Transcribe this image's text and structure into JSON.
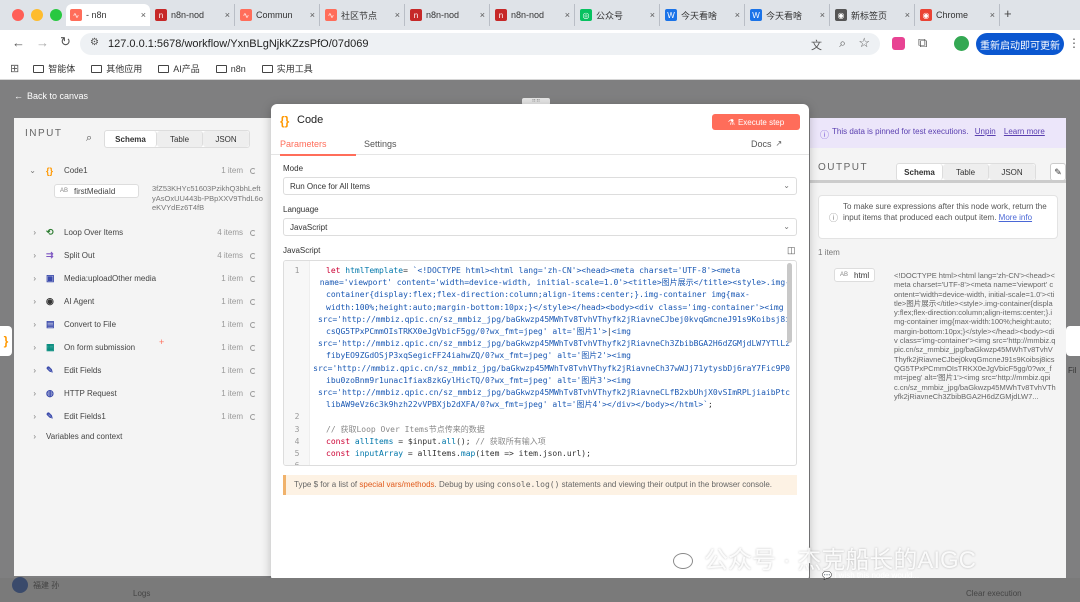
{
  "browser": {
    "tabs": [
      {
        "label": "- n8n",
        "color": "#ff6d5a",
        "glyph": "∿"
      },
      {
        "label": "n8n-nod",
        "color": "#c62828",
        "glyph": "n"
      },
      {
        "label": "Commun",
        "color": "#ff6d5a",
        "glyph": "∿"
      },
      {
        "label": "社区节点",
        "color": "#ff6d5a",
        "glyph": "∿"
      },
      {
        "label": "n8n-nod",
        "color": "#c62828",
        "glyph": "n"
      },
      {
        "label": "n8n-nod",
        "color": "#c62828",
        "glyph": "n"
      },
      {
        "label": "公众号",
        "color": "#07c160",
        "glyph": "◎"
      },
      {
        "label": "今天看啥",
        "color": "#1a73e8",
        "glyph": "W"
      },
      {
        "label": "今天看啥",
        "color": "#1a73e8",
        "glyph": "W"
      },
      {
        "label": "新标签页",
        "color": "#555",
        "glyph": "◉"
      },
      {
        "label": "Chrome",
        "color": "#ea4335",
        "glyph": "◉"
      }
    ],
    "new_tab": "+",
    "url": "127.0.0.1:5678/workflow/YxnBLgNjkKZzsPfO/07d069",
    "relaunch": "重新启动即可更新",
    "bookmarks": [
      "智能体",
      "其他应用",
      "AI产品",
      "n8n",
      "实用工具"
    ]
  },
  "back_to_canvas": "Back to canvas",
  "input": {
    "title": "INPUT",
    "tabs": [
      "Schema",
      "Table",
      "JSON"
    ],
    "items": [
      {
        "name": "Code1",
        "count": "1 item",
        "color": "#ff9800",
        "icon": "{}",
        "expanded": true
      },
      {
        "name": "Loop Over Items",
        "count": "4 items",
        "color": "#2e7d32",
        "icon": "⟲"
      },
      {
        "name": "Split Out",
        "count": "4 items",
        "color": "#7e57c2",
        "icon": "⇉"
      },
      {
        "name": "Media:uploadOther media",
        "count": "1 item",
        "color": "#3949ab",
        "icon": "▣"
      },
      {
        "name": "AI Agent",
        "count": "1 item",
        "color": "#333",
        "icon": "◉"
      },
      {
        "name": "Convert to File",
        "count": "1 item",
        "color": "#3949ab",
        "icon": "▤"
      },
      {
        "name": "On form submission",
        "count": "1 item",
        "color": "#00897b",
        "icon": "▦"
      },
      {
        "name": "Edit Fields",
        "count": "1 item",
        "color": "#3949ab",
        "icon": "✎"
      },
      {
        "name": "HTTP Request",
        "count": "1 item",
        "color": "#3949ab",
        "icon": "◍"
      },
      {
        "name": "Edit Fields1",
        "count": "1 item",
        "color": "#3949ab",
        "icon": "✎"
      }
    ],
    "field_type": "AB",
    "field_name": "firstMediaId",
    "field_value": "3fZ53KHYc51603PzikhQ3bhLeftyAsOxUU443b-PBpXXV9ThdL6oeKVYdEz6T4fB",
    "vars_context": "Variables and context"
  },
  "modal": {
    "icon": "{}",
    "title": "Code",
    "execute": "Execute step",
    "tabs": [
      "Parameters",
      "Settings"
    ],
    "docs": "Docs",
    "mode_label": "Mode",
    "mode_value": "Run Once for All Items",
    "lang_label": "Language",
    "lang_value": "JavaScript",
    "js_label": "JavaScript",
    "hint_prefix": "Type $ for a list of ",
    "hint_link": "special vars/methods",
    "hint_mid": ". Debug by using ",
    "hint_code": "console.log()",
    "hint_suffix": " statements and viewing their output in the browser console."
  },
  "code_lines": [
    {
      "n": "1",
      "t": [
        [
          "kw",
          "let "
        ],
        [
          "fn",
          "htmlTemplate"
        ],
        [
          "",
          "= "
        ],
        [
          "str",
          "`<!DOCTYPE html><html lang='zh-CN'><head><meta charset='UTF-8'><meta"
        ]
      ]
    },
    {
      "n": "",
      "t": [
        [
          "str",
          "name='viewport' content='width=device-width, initial-scale=1.0'><title>图片展示</title><style>.img-"
        ]
      ]
    },
    {
      "n": "",
      "t": [
        [
          "str",
          "container{display:flex;flex-direction:column;align-items:center;}.img-container img{max-"
        ]
      ]
    },
    {
      "n": "",
      "t": [
        [
          "str",
          "width:100%;height:auto;margin-bottom:10px;}</style></head><body><div class='img-container'><img"
        ]
      ]
    },
    {
      "n": "",
      "t": [
        [
          "str",
          "src='http://mmbiz.qpic.cn/sz_mmbiz_jpg/baGkwzp45MWhTv8TvhVThyfk2jRiavneCJbej0kvqGmcneJ91s9Koibsj8i"
        ]
      ]
    },
    {
      "n": "",
      "t": [
        [
          "str",
          "csQG5TPxPCmmOIsTRKX0eJgVbicF5gg/0?wx_fmt=jpeg' alt='图片1'>"
        ],
        [
          "",
          "|"
        ],
        [
          "str",
          "<img"
        ]
      ]
    },
    {
      "n": "",
      "t": [
        [
          "str",
          "src='http://mmbiz.qpic.cn/sz_mmbiz_jpg/baGkwzp45MWhTv8TvhVThyfk2jRiavneCh3ZbibBGA2H6dZGMjdLW7YTlLz"
        ]
      ]
    },
    {
      "n": "",
      "t": [
        [
          "str",
          "fibyEO9ZGdOSjP3xqSegicFF24iahwZQ/0?wx_fmt=jpeg' alt='图片2'><img"
        ]
      ]
    },
    {
      "n": "",
      "t": [
        [
          "str",
          "src='http://mmbiz.qpic.cn/sz_mmbiz_jpg/baGkwzp45MWhTv8TvhVThyfk2jRiavneCh37wWJj71ytysbDj6raY7Fic9P0"
        ]
      ]
    },
    {
      "n": "",
      "t": [
        [
          "str",
          "ibu0zoBnm9r1unac1fiax8zkGylHicTQ/0?wx_fmt=jpeg' alt='图片3'><img"
        ]
      ]
    },
    {
      "n": "",
      "t": [
        [
          "str",
          "src='http://mmbiz.qpic.cn/sz_mmbiz_jpg/baGkwzp45MWhTv8TvhVThyfk2jRiavneCLfB2xbUhjX0vSImRPLjiaibPtc"
        ]
      ]
    },
    {
      "n": "",
      "t": [
        [
          "str",
          "libAW9eVz6c3k9hzh22vVPBXjb2dXFA/0?wx_fmt=jpeg' alt='图片4'></div></body></html>`"
        ],
        [
          "",
          ";"
        ]
      ]
    },
    {
      "n": "2",
      "t": []
    },
    {
      "n": "3",
      "t": [
        [
          "cm",
          "// 获取Loop Over Items节点传来的数据"
        ]
      ]
    },
    {
      "n": "4",
      "t": [
        [
          "kw",
          "const "
        ],
        [
          "fn",
          "allItems"
        ],
        [
          "",
          " = $input."
        ],
        [
          "fn",
          "all"
        ],
        [
          "",
          "(); "
        ],
        [
          "cm",
          "// 获取所有输入项"
        ]
      ]
    },
    {
      "n": "5",
      "t": [
        [
          "kw",
          "const "
        ],
        [
          "fn",
          "inputArray"
        ],
        [
          "",
          " = allItems."
        ],
        [
          "fn",
          "map"
        ],
        [
          "",
          "(item => item.json.url);"
        ]
      ]
    },
    {
      "n": "6",
      "t": []
    }
  ],
  "output": {
    "pinned_text": "This data is pinned for test executions.",
    "unpin": "Unpin",
    "learn_more": "Learn more",
    "title": "OUTPUT",
    "tabs": [
      "Schema",
      "Table",
      "JSON"
    ],
    "info_text": "To make sure expressions after this node work, return the input items that produced each output item.",
    "info_link": "More info",
    "count": "1 item",
    "field_type": "AB",
    "field_name": "html",
    "field_value": "<!DOCTYPE html><html lang='zh-CN'><head><meta charset='UTF-8'><meta name='viewport' content='width=device-width, initial-scale=1.0'><title>图片展示</title><style>.img-container{display:flex;flex-direction:column;align-items:center;}.img-container img{max-width:100%;height:auto;margin-bottom:10px;}</style></head><body><div class='img-container'><img src='http://mmbiz.qpic.cn/sz_mmbiz_jpg/baGkwzp45MWhTv8TvhVThyfk2jRiavneCJbej0kvqGmcneJ91s9Koibsj8icsQG5TPxPCmmOIsTRKX0eJgVbicF5gg/0?wx_fmt=jpeg' alt='图片1'><img src='http://mmbiz.qpic.cn/sz_mmbiz_jpg/baGkwzp45MWhTv8TvhVThyfk2jRiavneCh3ZbibBGA2H6dZGMjdLW7...",
    "feedback": "I wish this node would..."
  },
  "bottom": {
    "user": "福建 孙",
    "logs": "Logs",
    "clear": "Clear execution"
  },
  "watermark": "公众号 · 杰克船长的AIGC"
}
